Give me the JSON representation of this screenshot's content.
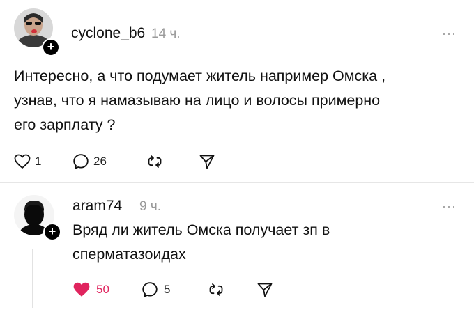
{
  "post": {
    "username": "cyclone_b6",
    "time": "14 ч.",
    "more": "···",
    "lines": [
      "Интересно, а что подумает житель например Омска ,",
      "узнав,  что я намазываю на лицо и волосы примерно",
      "его зарплату ?"
    ],
    "likes": "1",
    "comments": "26",
    "follow_glyph": "+",
    "avatar_icon": "user-avatar-photo",
    "like_icon": "heart-outline-icon"
  },
  "reply": {
    "username": "aram74",
    "time": "9 ч.",
    "more": "···",
    "lines": [
      "Вряд ли житель Омска получает зп в",
      "сперматазоидах"
    ],
    "likes": "50",
    "comments": "5",
    "follow_glyph": "+",
    "avatar_icon": "silhouette-avatar",
    "like_icon": "heart-filled-icon",
    "like_color": "#e0245e"
  }
}
